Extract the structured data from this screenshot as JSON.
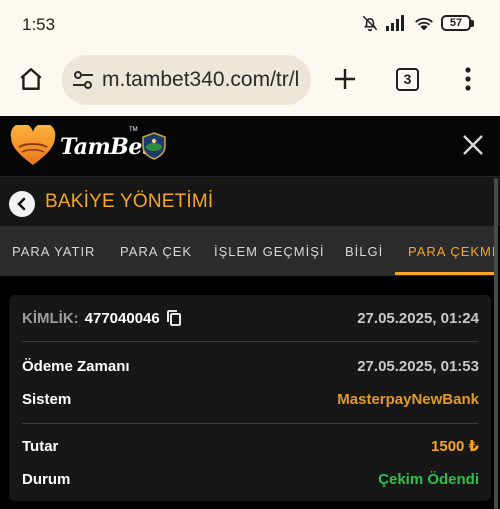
{
  "status_bar": {
    "time": "1:53",
    "battery": "57",
    "icons": [
      "bell-off-icon",
      "signal-icon",
      "wifi-icon",
      "battery-icon"
    ]
  },
  "browser": {
    "url": "m.tambet340.com/tr/l",
    "tab_count": "3",
    "icons": [
      "home-icon",
      "tune-icon",
      "plus-icon",
      "more-vert-icon"
    ]
  },
  "site": {
    "logo_text": "TamBet",
    "logo_tm": "TM"
  },
  "page": {
    "title": "BAKİYE YÖNETİMİ"
  },
  "tabs": [
    {
      "label": "PARA YATIR",
      "active": false
    },
    {
      "label": "PARA ÇEK",
      "active": false
    },
    {
      "label": "İŞLEM GEÇMİŞİ",
      "active": false
    },
    {
      "label": "BİLGİ",
      "active": false
    },
    {
      "label": "PARA ÇEKME",
      "active": true
    }
  ],
  "transaction": {
    "id_label": "KİMLİK:",
    "id_value": "477040046",
    "created_at": "27.05.2025, 01:24",
    "fields": [
      {
        "label": "Ödeme Zamanı",
        "value": "27.05.2025, 01:53"
      },
      {
        "label": "Sistem",
        "value": "MasterpayNewBank"
      },
      {
        "label": "Tutar",
        "value": "1500 ₺"
      },
      {
        "label": "Durum",
        "value": "Çekim Ödendi"
      }
    ]
  },
  "colors": {
    "accent": "#f5a623",
    "status_paid": "#2fbf4a",
    "system": "#e09a2a"
  }
}
